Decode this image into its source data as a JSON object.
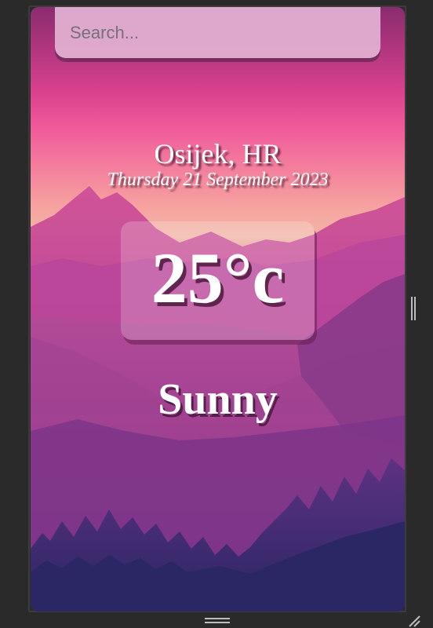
{
  "search": {
    "placeholder": "Search...",
    "value": ""
  },
  "weather": {
    "location": "Osijek, HR",
    "date": "Thursday 21 September 2023",
    "temperature": "25°c",
    "condition": "Sunny"
  },
  "colors": {
    "sky_top": "#8a2c6e",
    "sky_glow": "#f6a2a0",
    "mountain_far": "#c14a98",
    "lake_base": "#8b3a88",
    "forest_dark": "#3a2868",
    "search_bg": "#e2b2d2",
    "text": "#ffffff"
  },
  "icons": [
    "resize-handle-right-icon",
    "resize-handle-bottom-icon",
    "resize-corner-icon"
  ]
}
